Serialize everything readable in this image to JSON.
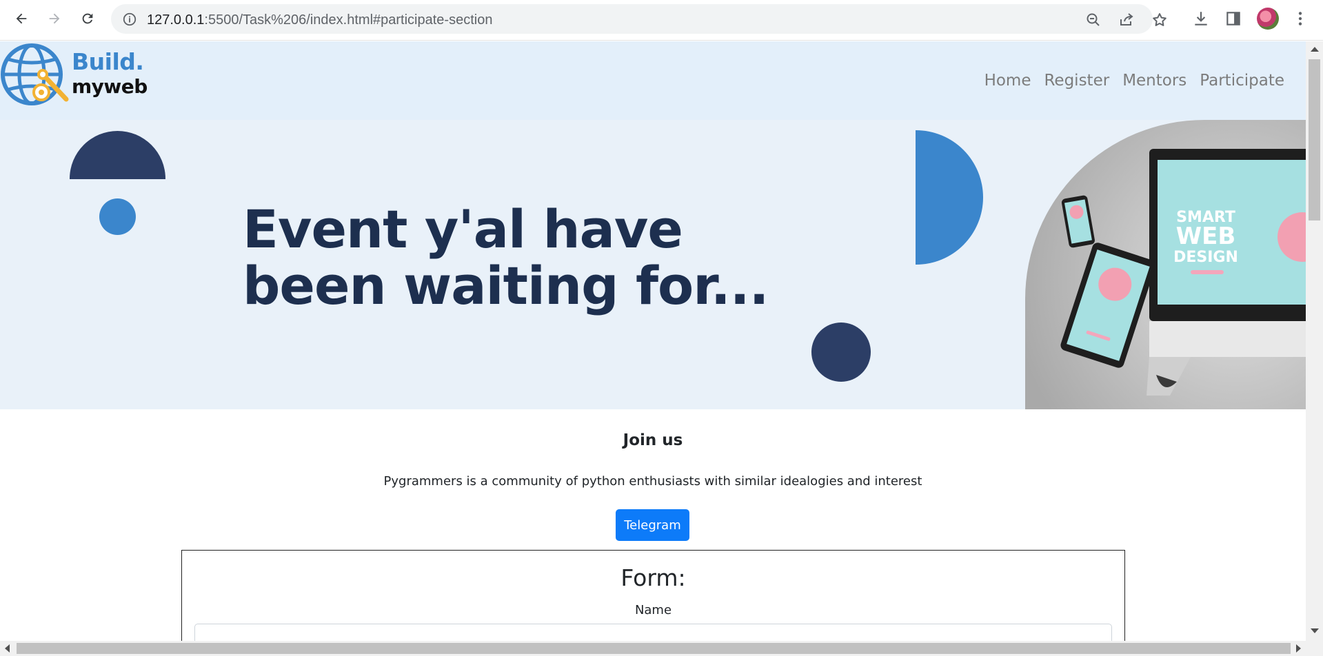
{
  "browser": {
    "url_host": "127.0.0.1",
    "url_path": ":5500/Task%206/index.html#participate-section"
  },
  "logo": {
    "line1": "Build.",
    "line2": "myweb"
  },
  "nav": {
    "items": [
      {
        "label": "Home"
      },
      {
        "label": "Register"
      },
      {
        "label": "Mentors"
      },
      {
        "label": "Participate"
      }
    ]
  },
  "hero": {
    "title_line1": "Event y'al have",
    "title_line2": "been waiting for...",
    "colors": {
      "dark": "#2c3e66",
      "accent": "#3b86cc",
      "background": "#e9f1f9"
    },
    "art": {
      "line1": "SMART",
      "line2": "WEB",
      "line3": "DESIGN"
    }
  },
  "participate": {
    "title": "Join us",
    "description": "Pygrammers is a community of python enthusiasts with similar idealogies and interest",
    "button_label": "Telegram"
  },
  "form": {
    "title": "Form:",
    "name_label": "Name",
    "name_value": ""
  }
}
